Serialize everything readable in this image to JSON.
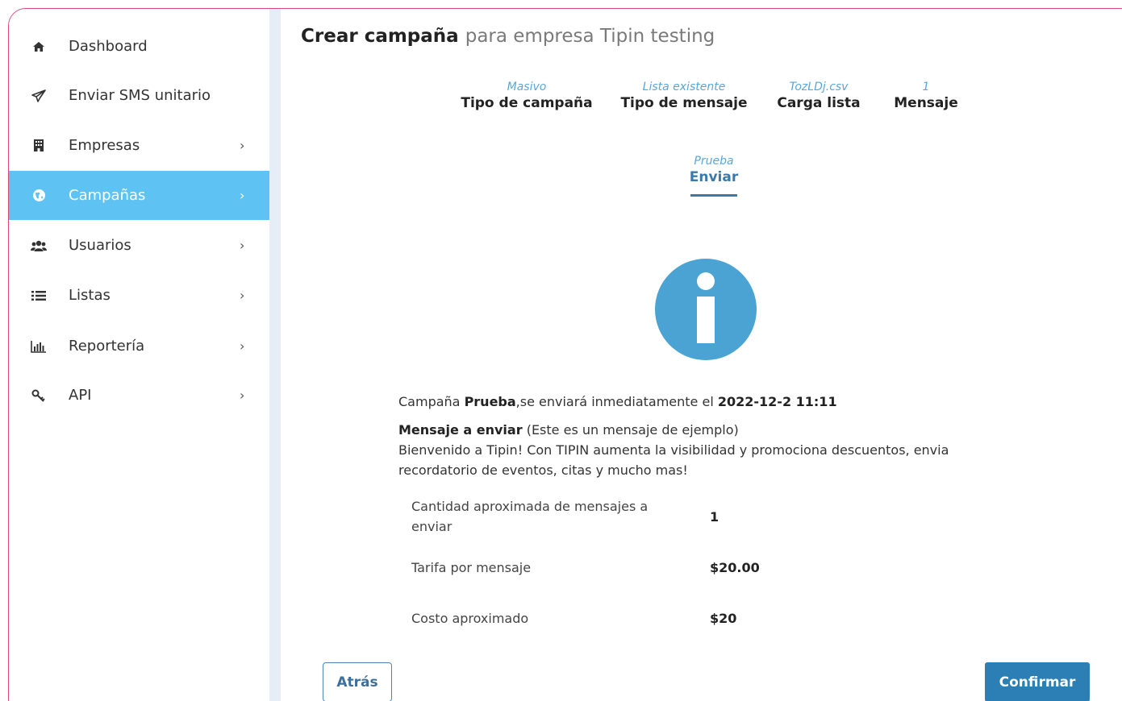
{
  "sidebar": {
    "items": [
      {
        "label": "Dashboard",
        "icon": "home-icon",
        "has_chevron": false,
        "active": false
      },
      {
        "label": "Enviar SMS unitario",
        "icon": "paper-plane-icon",
        "has_chevron": false,
        "active": false
      },
      {
        "label": "Empresas",
        "icon": "building-icon",
        "has_chevron": true,
        "active": false
      },
      {
        "label": "Campañas",
        "icon": "globe-icon",
        "has_chevron": true,
        "active": true
      },
      {
        "label": "Usuarios",
        "icon": "users-icon",
        "has_chevron": true,
        "active": false
      },
      {
        "label": "Listas",
        "icon": "list-icon",
        "has_chevron": true,
        "active": false
      },
      {
        "label": "Reportería",
        "icon": "bar-chart-icon",
        "has_chevron": true,
        "active": false
      },
      {
        "label": "API",
        "icon": "key-icon",
        "has_chevron": true,
        "active": false
      }
    ],
    "chevron": "›",
    "active_color": "#5ec3f2"
  },
  "header": {
    "title_bold": "Crear campaña",
    "title_rest": "para empresa Tipin testing"
  },
  "steps": [
    {
      "value": "Masivo",
      "label": "Tipo de campaña"
    },
    {
      "value": "Lista existente",
      "label": "Tipo de mensaje"
    },
    {
      "value": "TozLDj.csv",
      "label": "Carga lista"
    },
    {
      "value": "1",
      "label": "Mensaje"
    },
    {
      "value": "Prueba",
      "label": "Enviar"
    }
  ],
  "summary": {
    "campaign_prefix": "Campaña",
    "campaign_name": "Prueba",
    "campaign_middle": ",se enviará inmediatamente el",
    "campaign_datetime": "2022-12-2 11:11",
    "message_heading": "Mensaje a enviar",
    "message_note": "(Este es un mensaje de ejemplo)",
    "message_body": "Bienvenido a Tipin! Con TIPIN aumenta la visibilidad y promociona descuentos, envia recordatorio de eventos, citas y mucho mas!"
  },
  "costs": [
    {
      "label": "Cantidad aproximada de mensajes a enviar",
      "value": "1"
    },
    {
      "label": "Tarifa por mensaje",
      "value": "$20.00"
    },
    {
      "label": "Costo aproximado",
      "value": "$20"
    }
  ],
  "actions": {
    "back_label": "Atrás",
    "confirm_label": "Confirmar"
  },
  "colors": {
    "accent": "#2b7fb4",
    "info_icon": "#4aa3d3",
    "frame_border": "#e0457b"
  }
}
